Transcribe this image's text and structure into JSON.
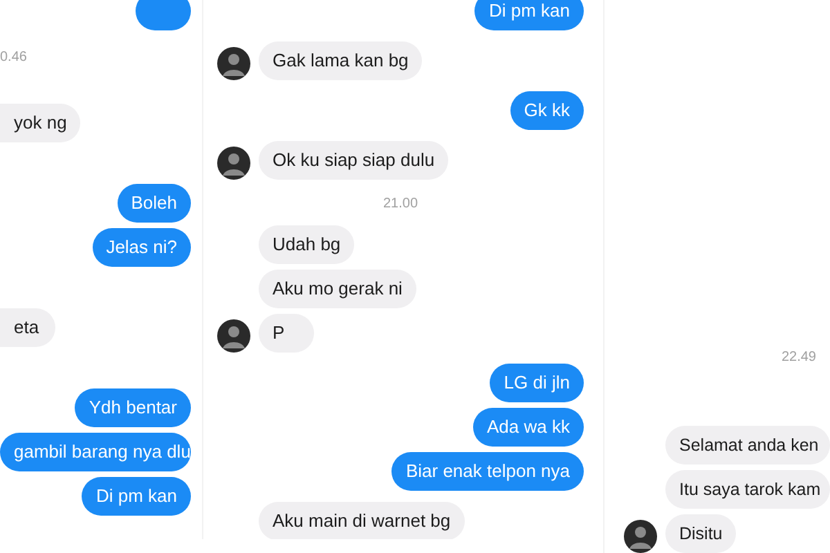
{
  "panels": [
    {
      "messages": [
        {
          "kind": "out"
        },
        {
          "kind": "time",
          "text": "0.46"
        },
        {
          "kind": "in",
          "text": "yok ng"
        },
        {
          "kind": "out",
          "text": "Boleh"
        },
        {
          "kind": "out",
          "text": "Jelas ni?"
        },
        {
          "kind": "in",
          "text": "eta"
        },
        {
          "kind": "out",
          "text": "Ydh bentar"
        },
        {
          "kind": "out",
          "text": "gambil barang nya dlu"
        },
        {
          "kind": "out",
          "text": "Di pm kan"
        }
      ]
    },
    {
      "messages": [
        {
          "kind": "out",
          "text": "Di pm kan"
        },
        {
          "kind": "in",
          "text": "Gak lama kan bg",
          "avatar": true
        },
        {
          "kind": "out",
          "text": "Gk kk"
        },
        {
          "kind": "in",
          "text": "Ok ku siap siap dulu",
          "avatar": true
        },
        {
          "kind": "time",
          "text": "21.00"
        },
        {
          "kind": "in",
          "text": "Udah bg",
          "avatar": false
        },
        {
          "kind": "in",
          "text": "Aku mo gerak ni",
          "avatar": false
        },
        {
          "kind": "in",
          "text": "P",
          "avatar": true
        },
        {
          "kind": "out",
          "text": "LG di jln"
        },
        {
          "kind": "out",
          "text": "Ada wa kk"
        },
        {
          "kind": "out",
          "text": "Biar enak telpon nya"
        },
        {
          "kind": "in",
          "text": "Aku main di warnet bg",
          "avatar": false
        }
      ]
    },
    {
      "messages": [
        {
          "kind": "time",
          "text": "22.49"
        },
        {
          "kind": "in",
          "text": "Selamat anda ken",
          "avatar": false
        },
        {
          "kind": "in",
          "text": "Itu saya tarok kam",
          "avatar": false
        },
        {
          "kind": "in",
          "text": "Disitu",
          "avatar": true
        }
      ]
    }
  ]
}
